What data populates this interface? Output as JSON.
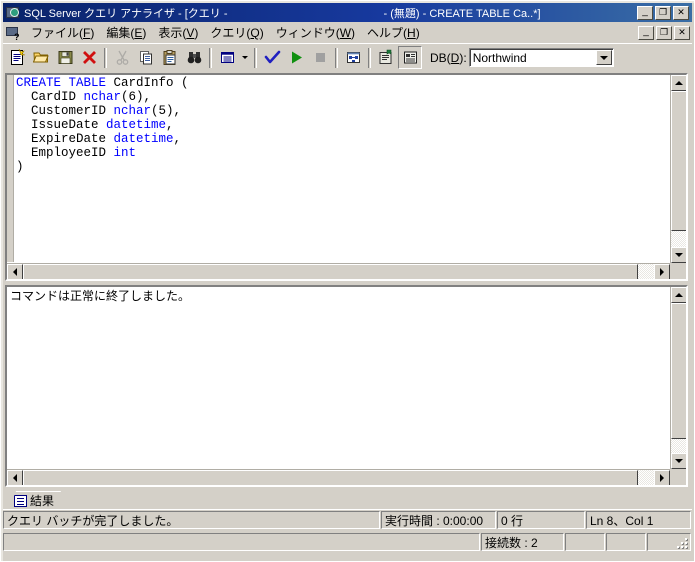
{
  "window": {
    "title_prefix": "SQL Server クエリ アナライザ - [クエリ - ",
    "title_suffix": " - (無題) - CREATE TABLE Ca..*]",
    "redacted_note": "",
    "icon": "query-analyzer-icon",
    "buttons": {
      "minimize": "_",
      "maximize": "❐",
      "close": "✕"
    }
  },
  "menu": {
    "mdi_icon": "mdi-document-icon",
    "items": [
      {
        "name": "file",
        "pre": "ファイル(",
        "acc": "F",
        "post": ")"
      },
      {
        "name": "edit",
        "pre": "編集(",
        "acc": "E",
        "post": ")"
      },
      {
        "name": "view",
        "pre": "表示(",
        "acc": "V",
        "post": ")"
      },
      {
        "name": "query",
        "pre": "クエリ(",
        "acc": "Q",
        "post": ")"
      },
      {
        "name": "window",
        "pre": "ウィンドウ(",
        "acc": "W",
        "post": ")"
      },
      {
        "name": "help",
        "pre": "ヘルプ(",
        "acc": "H",
        "post": ")"
      }
    ],
    "child_buttons": {
      "minimize": "_",
      "restore": "❐",
      "close": "✕"
    }
  },
  "toolbar": {
    "buttons": [
      {
        "name": "new-query-icon",
        "title": "新しいクエリ"
      },
      {
        "name": "open-file-icon",
        "title": "ファイルを開く"
      },
      {
        "name": "save-query-icon",
        "title": "クエリの保存"
      },
      {
        "name": "clear-window-icon",
        "title": "ウィンドウのクリア"
      },
      {
        "name": "cut-icon",
        "title": "切り取り"
      },
      {
        "name": "copy-icon",
        "title": "コピー"
      },
      {
        "name": "paste-icon",
        "title": "貼り付け"
      },
      {
        "name": "find-icon",
        "title": "検索"
      },
      {
        "name": "results-mode-icon",
        "title": "結果の表示方法"
      },
      {
        "name": "parse-check-icon",
        "title": "クエリの解析"
      },
      {
        "name": "execute-play-icon",
        "title": "クエリの実行"
      },
      {
        "name": "stop-icon",
        "title": "停止"
      },
      {
        "name": "execution-plan-icon",
        "title": "実行プランの表示"
      },
      {
        "name": "object-browser-icon",
        "title": "オブジェクト ブラウザ"
      },
      {
        "name": "templates-icon",
        "title": "テンプレート"
      }
    ],
    "db_label_pre": "DB(",
    "db_label_acc": "D",
    "db_label_post": "):",
    "db_value": "Northwind"
  },
  "editor": {
    "code_lines": [
      {
        "segments": [
          {
            "t": "CREATE TABLE",
            "k": true
          },
          {
            "t": " CardInfo (",
            "k": false
          }
        ]
      },
      {
        "segments": [
          {
            "t": "  CardID ",
            "k": false
          },
          {
            "t": "nchar",
            "k": true
          },
          {
            "t": "(6),",
            "k": false
          }
        ]
      },
      {
        "segments": [
          {
            "t": "  CustomerID ",
            "k": false
          },
          {
            "t": "nchar",
            "k": true
          },
          {
            "t": "(5),",
            "k": false
          }
        ]
      },
      {
        "segments": [
          {
            "t": "  IssueDate ",
            "k": false
          },
          {
            "t": "datetime",
            "k": true
          },
          {
            "t": ",",
            "k": false
          }
        ]
      },
      {
        "segments": [
          {
            "t": "  ExpireDate ",
            "k": false
          },
          {
            "t": "datetime",
            "k": true
          },
          {
            "t": ",",
            "k": false
          }
        ]
      },
      {
        "segments": [
          {
            "t": "  EmployeeID ",
            "k": false
          },
          {
            "t": "int",
            "k": true
          }
        ]
      },
      {
        "segments": [
          {
            "t": ")",
            "k": false
          }
        ]
      }
    ]
  },
  "results": {
    "message": "コマンドは正常に終了しました。",
    "tab_label": "結果",
    "tab_icon": "grid-results-icon"
  },
  "statusbar": {
    "row1": {
      "message": "クエリ バッチが完了しました。",
      "exec_time": "実行時間 : 0:00:00",
      "rows": "0 行",
      "position": "Ln 8、Col 1"
    },
    "row2": {
      "connections": "接続数 : 2",
      "field_a": "",
      "field_b": "",
      "field_c": ""
    }
  },
  "colors": {
    "titlebar_start": "#0a246a",
    "titlebar_end": "#3a6ea5",
    "face": "#d4d0c8",
    "keyword": "#0000ff",
    "text": "#000000",
    "editor_bg": "#ffffff"
  }
}
